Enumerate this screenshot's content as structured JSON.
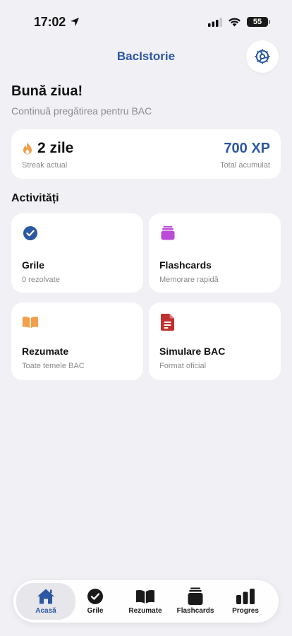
{
  "status_bar": {
    "time": "17:02",
    "battery": "55"
  },
  "header": {
    "title": "BacIstorie"
  },
  "greeting": {
    "title": "Bună ziua!",
    "subtitle": "Continuă pregătirea pentru BAC"
  },
  "stats": {
    "streak_value": "2 zile",
    "streak_label": "Streak actual",
    "xp_value": "700 XP",
    "xp_label": "Total acumulat"
  },
  "activities": {
    "section_title": "Activități",
    "items": [
      {
        "title": "Grile",
        "subtitle": "0 rezolvate",
        "icon": "checkmark-circle-icon",
        "color": "#2c57a1"
      },
      {
        "title": "Flashcards",
        "subtitle": "Memorare rapidă",
        "icon": "cards-stack-icon",
        "color": "#b94bd6"
      },
      {
        "title": "Rezumate",
        "subtitle": "Toate temele BAC",
        "icon": "open-book-icon",
        "color": "#f0a04b"
      },
      {
        "title": "Simulare BAC",
        "subtitle": "Format oficial",
        "icon": "document-icon",
        "color": "#c0312f"
      }
    ]
  },
  "tab_bar": {
    "active": "Acasă",
    "items": [
      {
        "label": "Acasă",
        "icon": "house-icon"
      },
      {
        "label": "Grile",
        "icon": "checkmark-circle-icon"
      },
      {
        "label": "Rezumate",
        "icon": "open-book-icon"
      },
      {
        "label": "Flashcards",
        "icon": "cards-stack-icon"
      },
      {
        "label": "Progres",
        "icon": "bar-chart-icon"
      }
    ]
  },
  "colors": {
    "accent": "#2c57a1",
    "background": "#f1f0f5",
    "streak_flame": "#f0a04b"
  }
}
